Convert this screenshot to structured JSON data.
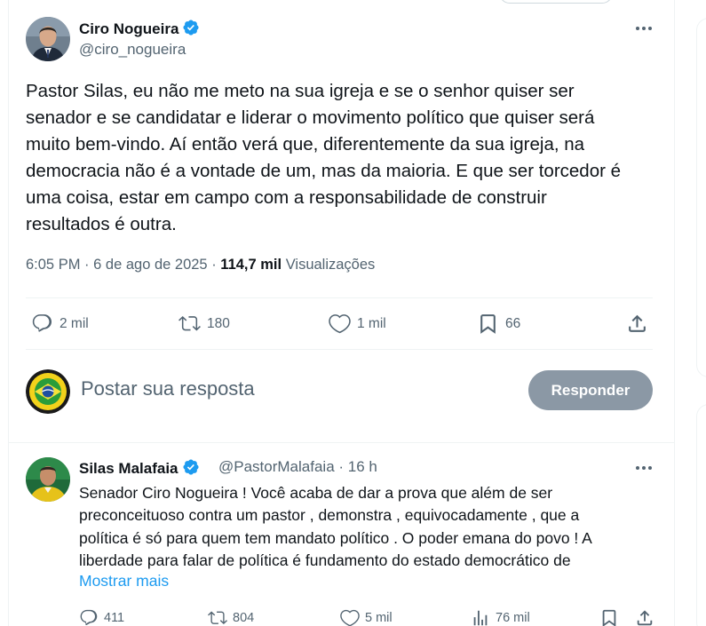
{
  "tweet": {
    "author_name": "Ciro Nogueira",
    "author_handle": "@ciro_nogueira",
    "text": "Pastor Silas, eu não me meto na sua igreja e se o senhor quiser ser\nsenador e se candidatar e liderar o movimento político que quiser será\nmuito bem-vindo. Aí então verá que, diferentemente da sua igreja, na\ndemocracia não é a vontade de um, mas da maioria. E que ser torcedor é\numa coisa, estar em campo com a responsabilidade de construir\nresultados é outra.",
    "time": "6:05 PM",
    "date": "6 de ago de 2025",
    "separator": "·",
    "views_count": "114,7 mil",
    "views_label": "Visualizações",
    "actions": {
      "replies": "2 mil",
      "retweets": "180",
      "likes": "1 mil",
      "bookmarks": "66"
    }
  },
  "composer": {
    "placeholder": "Postar sua resposta",
    "button_label": "Responder"
  },
  "reply": {
    "author_name": "Silas Malafaia",
    "author_handle": "@PastorMalafaia",
    "relative_time": "16 h",
    "text": "Senador Ciro Nogueira ! Você acaba de dar a prova que além de ser\npreconceituoso contra um pastor , demonstra , equivocadamente , que a\npolítica é só para quem tem mandato político . O poder emana do povo ! A\nliberdade para falar de política é fundamento do estado democrático de",
    "show_more": "Mostrar mais",
    "actions": {
      "replies": "411",
      "retweets": "804",
      "likes": "5 mil",
      "views": "76 mil"
    }
  },
  "colors": {
    "verified_blue": "#1d9bf0",
    "text_primary": "#0f1419",
    "text_secondary": "#536471",
    "button_disabled": "#8b98a5"
  },
  "icons": [
    "verified-badge-icon",
    "more-icon",
    "reply-icon",
    "retweet-icon",
    "like-icon",
    "bookmark-icon",
    "share-icon",
    "views-icon"
  ]
}
